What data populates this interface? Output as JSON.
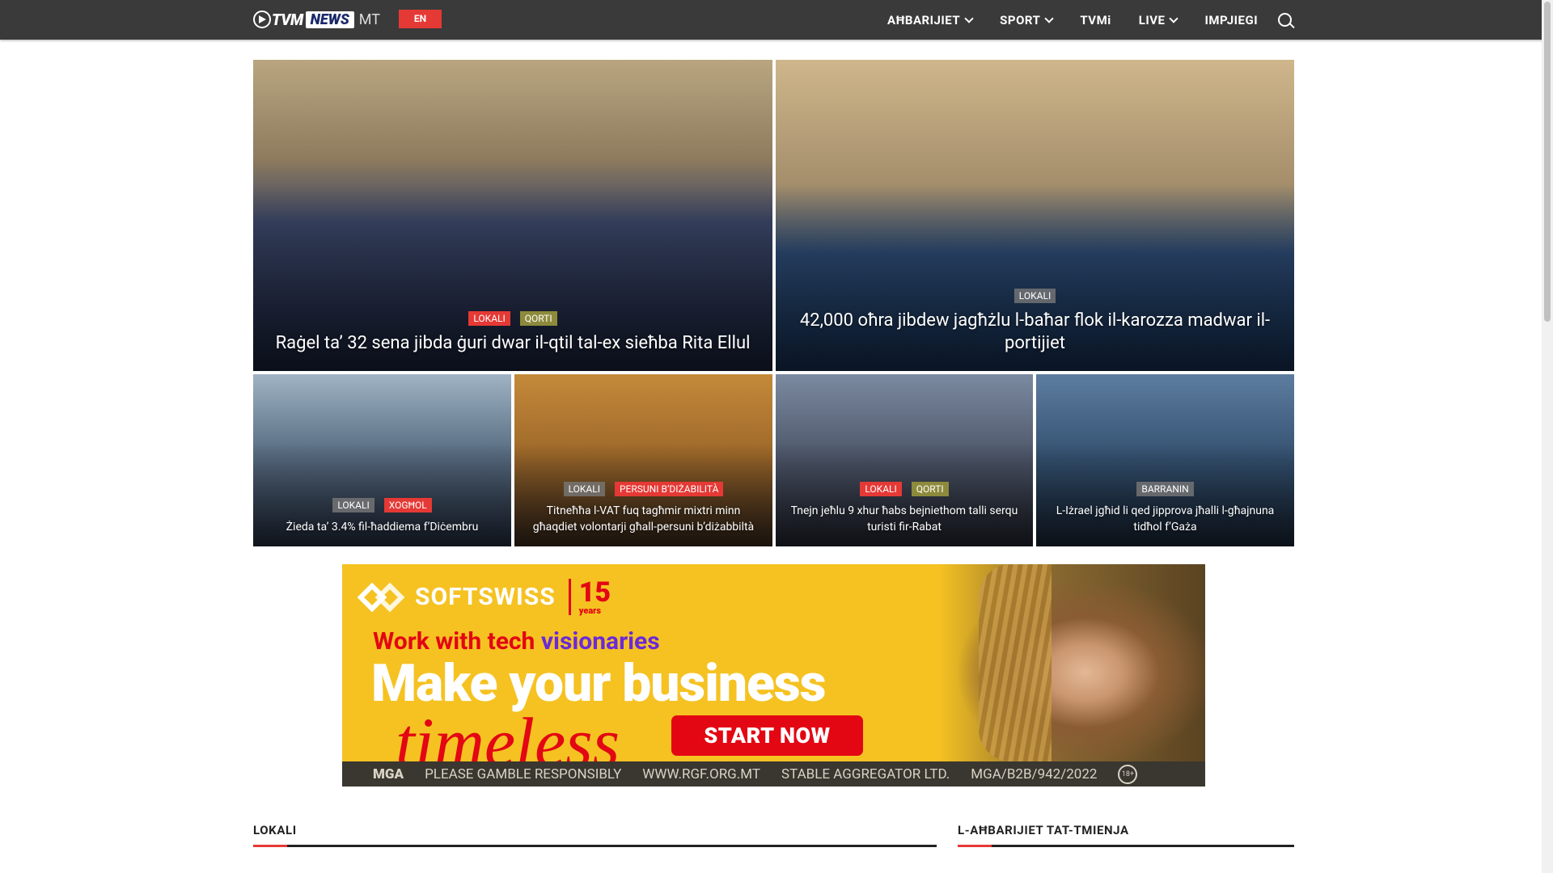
{
  "header": {
    "logo_tvm": "TVM",
    "logo_news": "NEWS",
    "logo_suffix": "MT",
    "lang_button": "EN",
    "nav": [
      {
        "label": "AĦBARIJIET",
        "has_dropdown": true
      },
      {
        "label": "SPORT",
        "has_dropdown": true
      },
      {
        "label": "TVMi",
        "has_dropdown": false
      },
      {
        "label": "LIVE",
        "has_dropdown": true
      },
      {
        "label": "IMPJIEGI",
        "has_dropdown": false
      }
    ],
    "search_icon": "search-icon"
  },
  "featured": [
    {
      "categories": [
        "LOKALI",
        "QORTI"
      ],
      "title": "Raġel ta’ 32 sena jibda ġuri dwar il-qtil tal-ex sieħba Rita Ellul"
    },
    {
      "categories": [
        "LOKALI"
      ],
      "title": "42,000 oħra jibdew jagħżlu l-baħar flok il-karozza madwar il-portijiet"
    },
    {
      "categories": [
        "LOKALI",
        "XOGĦOL"
      ],
      "title": "Żieda ta’ 3.4% fil-ħaddiema f’Diċembru"
    },
    {
      "categories": [
        "LOKALI",
        "PERSUNI B’DIŻABILITÀ"
      ],
      "title": "Titneħħa l-VAT fuq tagħmir mixtri minn għaqdiet volontarji għall-persuni b’diżabbiltà"
    },
    {
      "categories": [
        "LOKALI",
        "QORTI"
      ],
      "title": "Tnejn jeħlu 9 xhur ħabs bejniethom talli serqu turisti fir-Rabat"
    },
    {
      "categories": [
        "BARRANIN"
      ],
      "title": "L-Iżrael jgħid li qed jipprova jħalli l-għajnuna tidħol f’Gaża"
    }
  ],
  "ad": {
    "brand": "SOFTSWISS",
    "years_number": "15",
    "years_label": "years",
    "tagline_part1": "Work with tech ",
    "tagline_part2": "visionaries",
    "headline": "Make your business",
    "script": "timeless",
    "cta": "START NOW",
    "footer": [
      "MGA",
      "PLEASE GAMBLE RESPONSIBLY",
      "WWW.RGF.ORG.MT",
      "STABLE AGGREGATOR LTD.",
      "MGA/B2B/942/2022",
      "18+"
    ]
  },
  "sections": {
    "left": "LOKALI",
    "right": "L-AĦBARIJIET TAT-TMIENJA"
  }
}
